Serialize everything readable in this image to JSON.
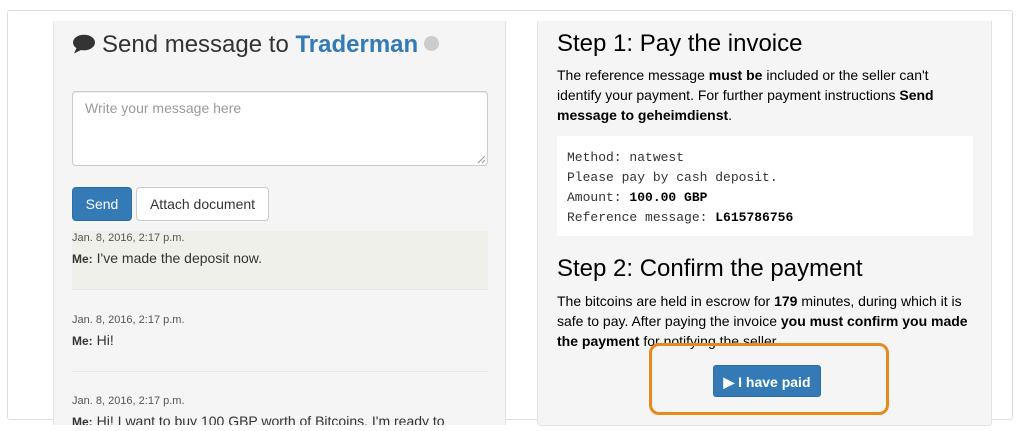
{
  "chat": {
    "title_prefix": "Send message to",
    "seller": "Traderman",
    "placeholder": "Write your message here",
    "send_label": "Send",
    "attach_label": "Attach document",
    "messages": [
      {
        "time": "Jan. 8, 2016, 2:17 p.m.",
        "sender": "Me:",
        "text": "I've made the deposit now."
      },
      {
        "time": "Jan. 8, 2016, 2:17 p.m.",
        "sender": "Me:",
        "text": "Hi!"
      },
      {
        "time": "Jan. 8, 2016, 2:17 p.m.",
        "sender": "Me:",
        "text": "Hi! I want to buy 100 GBP worth of Bitcoins. I'm ready to"
      }
    ]
  },
  "step1": {
    "title": "Step 1: Pay the invoice",
    "t1": "The reference message ",
    "b1": "must be",
    "t2": " included or the seller can't identify your payment. For further payment instructions ",
    "b2": "Send message to geheimdienst",
    "t3": ".",
    "method_label": "Method:",
    "method_value": "natwest",
    "instruction": "Please pay by cash deposit.",
    "amount_label": "Amount:",
    "amount_value": "100.00 GBP",
    "reference_label": "Reference message:",
    "reference_value": "L615786756"
  },
  "step2": {
    "title": "Step 2: Confirm the payment",
    "t1": "The bitcoins are held in escrow for ",
    "minutes": "179",
    "t2": " minutes, during which it is safe to pay. After paying the invoice ",
    "b1": "you must confirm you made the payment",
    "t3": " for notifying the seller.",
    "button_label": "▶ I have paid"
  },
  "colors": {
    "primary": "#337ab7",
    "highlight_ring": "#e8891d",
    "panel_bg": "#f5f5f5"
  }
}
